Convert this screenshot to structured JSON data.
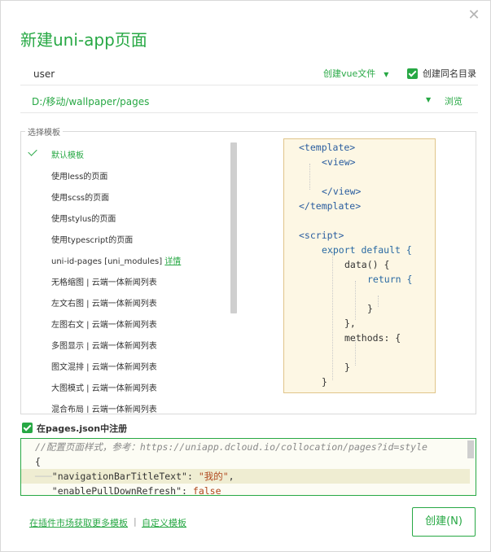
{
  "dialog": {
    "title": "新建uni-app页面",
    "close_icon": "close-icon"
  },
  "name_input": {
    "value": "user",
    "placeholder": ""
  },
  "file_type": {
    "label": "创建vue文件",
    "icon": "chevron-down-icon"
  },
  "create_dir": {
    "checked": true,
    "label": "创建同名目录"
  },
  "path": {
    "value": "D:/移动/wallpaper/pages",
    "browse_label": "浏览"
  },
  "templates": {
    "legend": "选择模板",
    "selected_index": 0,
    "items": [
      {
        "label": "默认模板"
      },
      {
        "label": "使用less的页面"
      },
      {
        "label": "使用scss的页面"
      },
      {
        "label": "使用stylus的页面"
      },
      {
        "label": "使用typescript的页面"
      },
      {
        "label": "uni-id-pages [uni_modules]",
        "link": "详情"
      },
      {
        "label": "无格缩图 | 云端一体新闻列表"
      },
      {
        "label": "左文右图 | 云端一体新闻列表"
      },
      {
        "label": "左图右文 | 云端一体新闻列表"
      },
      {
        "label": "多图显示 | 云端一体新闻列表"
      },
      {
        "label": "图文混排 | 云端一体新闻列表"
      },
      {
        "label": "大图模式 | 云端一体新闻列表"
      },
      {
        "label": "混合布局 | 云端一体新闻列表"
      }
    ]
  },
  "preview": {
    "lines": [
      "<template>",
      "<view>",
      "</view>",
      "</template>",
      "<script>",
      "export default {",
      "data() {",
      "return {",
      "}",
      "},",
      "methods: {",
      "}",
      "}"
    ]
  },
  "register": {
    "checked": true,
    "label": "在pages.json中注册"
  },
  "editor": {
    "comment": "//配置页面样式，参考：https://uniapp.dcloud.io/collocation/pages?id=style",
    "brace": "{",
    "line1_key": "\"navigationBarTitleText\"",
    "line1_value": "\"我的\"",
    "line2_key": "\"enablePullDownRefresh\"",
    "line2_value": "false"
  },
  "footer": {
    "market_link": "在插件市场获取更多模板",
    "separator": "|",
    "custom_link": "自定义模板",
    "create_button": "创建(N)"
  }
}
